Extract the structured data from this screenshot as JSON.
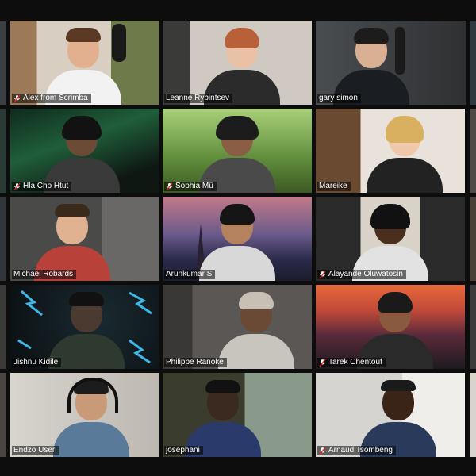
{
  "grid": {
    "background": "#0d0d0d",
    "speaker_highlight": "#c8c16a",
    "tiles": [
      {
        "name": "Alex from Scrimba",
        "muted": true
      },
      {
        "name": "Leanne Rybintsev",
        "muted": false
      },
      {
        "name": "gary simon",
        "muted": false
      },
      {
        "name": "Hla Cho Htut",
        "muted": true
      },
      {
        "name": "Sophia Mü",
        "muted": true
      },
      {
        "name": "Mareike",
        "muted": false
      },
      {
        "name": "Michael Robards",
        "muted": false
      },
      {
        "name": "Arunkumar S",
        "muted": false
      },
      {
        "name": "Alayande Oluwatosin",
        "muted": true
      },
      {
        "name": "Jishnu Kidile",
        "muted": false
      },
      {
        "name": "Philippe Ranoke",
        "muted": false
      },
      {
        "name": "Tarek Chentouf",
        "muted": true
      },
      {
        "name": "Endzo Useri",
        "muted": false
      },
      {
        "name": "josephani",
        "muted": false
      },
      {
        "name": "Arnaud Tsombeng",
        "muted": true
      }
    ]
  }
}
